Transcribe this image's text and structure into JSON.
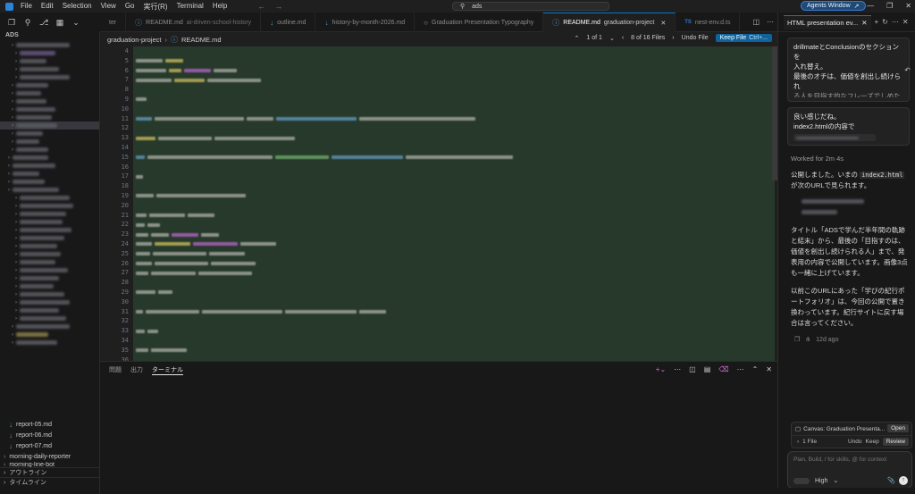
{
  "menu": [
    "File",
    "Edit",
    "Selection",
    "View",
    "Go",
    "実行(R)",
    "Terminal",
    "Help"
  ],
  "search": {
    "value": "ads"
  },
  "agents_button": "Agents Window",
  "sidebar": {
    "root": "ADS",
    "files": [
      "report-05.md",
      "report-06.md",
      "report-07.md"
    ],
    "folder": "morning-daily-reporter",
    "cut_item": "morning-line-bot",
    "outline": "アウトライン",
    "timeline": "タイムライン"
  },
  "tabs": [
    {
      "label": "ter",
      "sub": "",
      "icon": ""
    },
    {
      "label": "README.md",
      "sub": "ai-driven-school-history",
      "icon": "md"
    },
    {
      "label": "outline.md",
      "sub": "",
      "icon": "md"
    },
    {
      "label": "history-by-month-2026.md",
      "sub": "",
      "icon": "md"
    },
    {
      "label": "Graduation Presentation Typography",
      "sub": "",
      "icon": "preview"
    },
    {
      "label": "README.md",
      "sub": "graduation-project",
      "icon": "md",
      "active": true
    },
    {
      "label": "nest-env.d.ts",
      "sub": "",
      "icon": "ts"
    }
  ],
  "breadcrumb": [
    "graduation-project",
    "README.md"
  ],
  "diffbar": {
    "change_count": "1 of 1",
    "file_count": "8 of 16 Files",
    "undo": "Undo File",
    "keep": "Keep File",
    "keep_shortcut": "Ctrl+..."
  },
  "editor": {
    "line_numbers": [
      "4",
      "5",
      "6",
      "7",
      "8",
      "9",
      "10",
      "11",
      "12",
      "13",
      "14",
      "15",
      "16",
      "17",
      "18",
      "19",
      "20",
      "21",
      "22",
      "23",
      "24",
      "25",
      "26",
      "27",
      "28",
      "29",
      "30",
      "31",
      "32",
      "33",
      "34",
      "35",
      "36",
      "37"
    ]
  },
  "panel": {
    "tabs": [
      "問題",
      "出力",
      "ターミナル"
    ],
    "active_tab": "ターミナル"
  },
  "chat": {
    "tab_title": "HTML presentation ev...",
    "msg1_lines": [
      "drillmateとConclusionのセクションを",
      "入れ替え。",
      "最後のオチは、価値を創出し続けられ",
      "る人を目指す的なフレーズでしめたい"
    ],
    "msg2_lines": [
      "良い感じだね。",
      "index2.htmlの内容で"
    ],
    "worked": "Worked for 2m 4s",
    "reply_pre": "公開しました。いまの ",
    "reply_code": "index2.html",
    "reply_post": " が次のURLで見られます。",
    "reply_p2": "タイトル「ADSで学んだ半年間の軌跡と結末」から、最後の「目指すのは、価値を創出し続けられる人」まで、発表用の内容で公開しています。画像3点も一緒に上げています。",
    "reply_p3": "以前このURLにあった「学びの紀行ポートフォリオ」は、今回の公開で置き換わっています。紀行サイトに戻す場合は言ってください。",
    "reply_time": "12d ago",
    "canvas_title": "Canvas: Graduation Presenta...",
    "canvas_open": "Open",
    "files_label": "1 File",
    "undo": "Undo",
    "keep": "Keep",
    "review": "Review",
    "input_placeholder": "Plan, Build, / for skills, @ for context",
    "model_level": "High"
  }
}
